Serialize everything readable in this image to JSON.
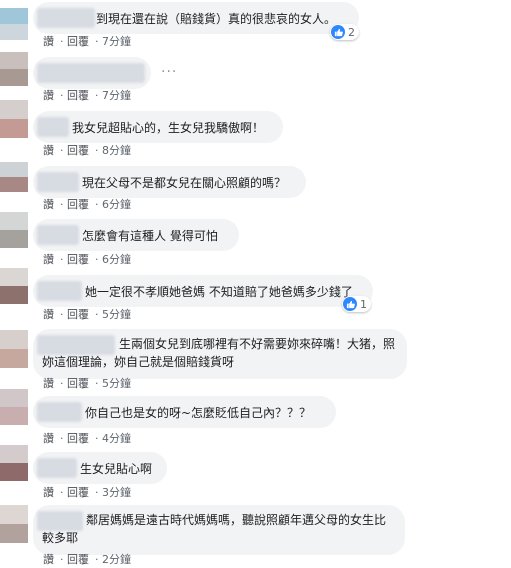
{
  "comments": [
    {
      "text": "到現在還在說（賠錢貨）真的很悲哀的女人。",
      "like": "讚",
      "reply": "回覆",
      "time": "7分鐘",
      "reactions": "2"
    },
    {
      "text": "",
      "like": "讚",
      "reply": "回覆",
      "time": "7分鐘",
      "more": "···"
    },
    {
      "text": "我女兒超貼心的，生女兒我驕傲啊！",
      "like": "讚",
      "reply": "回覆",
      "time": "8分鐘"
    },
    {
      "text": "現在父母不是都女兒在關心照顧的嗎？",
      "like": "讚",
      "reply": "回覆",
      "time": "6分鐘"
    },
    {
      "text": "怎麼會有這種人 覺得可怕",
      "like": "讚",
      "reply": "回覆",
      "time": "6分鐘"
    },
    {
      "text": "她一定很不孝順她爸媽 不知道賠了她爸媽多少錢了",
      "like": "讚",
      "reply": "回覆",
      "time": "5分鐘",
      "reactions": "1"
    },
    {
      "text": "生兩個女兒到底哪裡有不好需要妳來碎嘴！大猪，照妳這個理論，妳自己就是個賠錢貨呀",
      "like": "讚",
      "reply": "回覆",
      "time": "5分鐘"
    },
    {
      "text": "你自己也是女的呀~怎麼貶低自己內？？？",
      "like": "讚",
      "reply": "回覆",
      "time": "4分鐘"
    },
    {
      "text": "生女兒貼心啊",
      "like": "讚",
      "reply": "回覆",
      "time": "3分鐘"
    },
    {
      "text": "鄰居媽媽是遠古時代媽媽嗎，聽說照顧年邁父母的女生比較多耶",
      "like": "讚",
      "reply": "回覆",
      "time": "2分鐘"
    }
  ]
}
